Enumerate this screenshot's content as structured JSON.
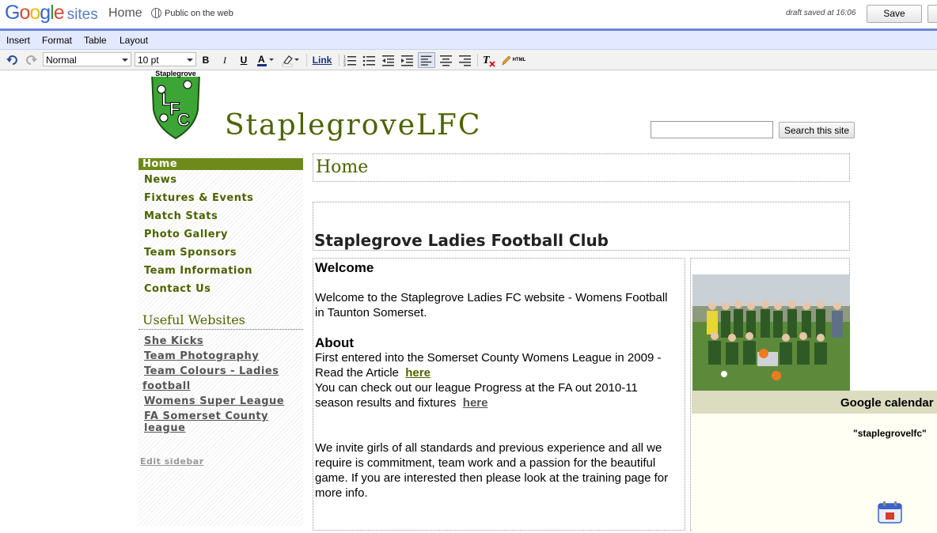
{
  "header": {
    "logo_google": "Google",
    "logo_sites": "sites",
    "page_name": "Home",
    "visibility": "Public on the web",
    "draft_status": "draft saved at 16:06",
    "save_label": "Save"
  },
  "menu": [
    "Insert",
    "Format",
    "Table",
    "Layout"
  ],
  "toolbar": {
    "style_select": "Normal",
    "size_select": "10 pt",
    "bold": "B",
    "italic": "I",
    "underline": "U",
    "link": "Link",
    "html": "HTML"
  },
  "site": {
    "title": "StaplegroveLFC",
    "logo_text": "LFC",
    "logo_banner": "Staplegrove",
    "search_value": "",
    "search_button": "Search this site"
  },
  "sidebar": {
    "nav": [
      "Home",
      "News",
      "Fixtures & Events",
      "Match Stats",
      "Photo Gallery",
      "Team Sponsors",
      "Team Information",
      "Contact Us"
    ],
    "useful_title": "Useful Websites",
    "useful_links": [
      "She Kicks",
      "Team Photography",
      "Team Colours - Ladies",
      "football",
      "Womens Super League",
      "FA Somerset County league"
    ],
    "edit_label": "Edit sidebar"
  },
  "main": {
    "page_heading": "Home",
    "club_title": "Staplegrove Ladies Football Club",
    "welcome_heading": "Welcome",
    "welcome_line1": "Welcome to the Staplegrove Ladies FC website - Womens Football",
    "welcome_line2": "in Taunton Somerset.",
    "about_heading": "About",
    "about_line1": "First entered into the Somerset County Womens League in 2009 -",
    "about_line2_pre": "Read the Article",
    "about_link1": "here",
    "about_line3": "You can check out our league Progress at the FA out 2010-11",
    "about_line4_pre": "season results and fixtures",
    "about_link2": "here",
    "invite_line1": "We invite girls of all standards and previous experience and all we",
    "invite_line2": "require is commitment, team work and a passion for the beautiful",
    "invite_line3": "game. If you are interested then please look at the training page for",
    "invite_line4": "more info."
  },
  "calendar": {
    "title": "Google calendar",
    "name": "\"staplegrovelfc\""
  },
  "colors": {
    "accent_green": "#4c6300",
    "nav_active": "#6f8a1a",
    "menu_bar": "#e3e9ff"
  }
}
